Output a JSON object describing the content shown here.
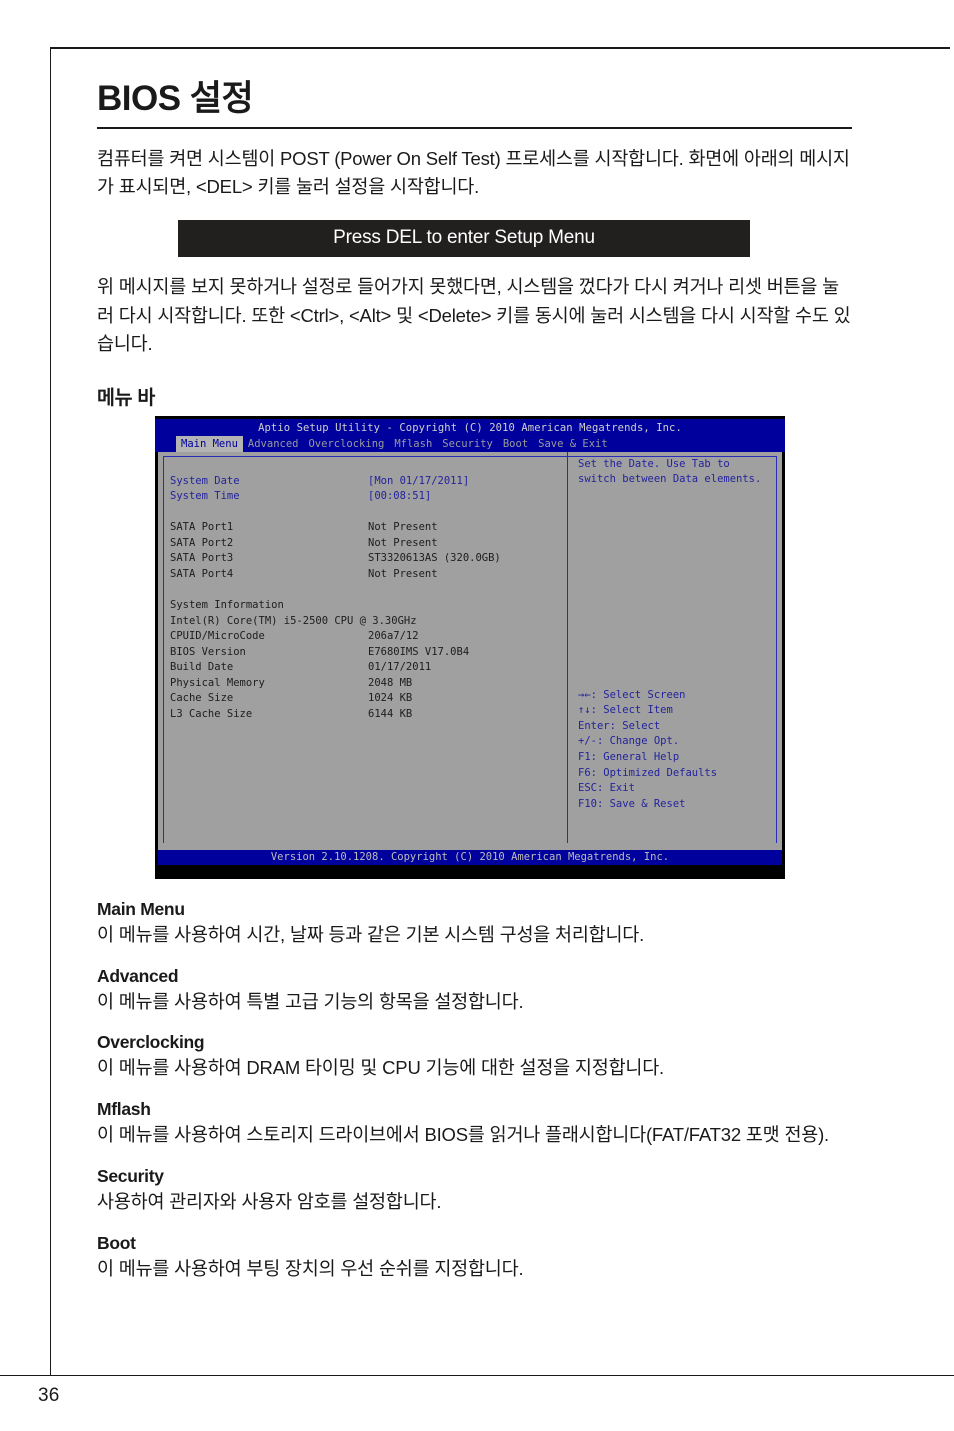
{
  "page": {
    "title": "BIOS 설정",
    "number": "36"
  },
  "intro": {
    "paragraph1": "컴퓨터를 켜면 시스템이 POST (Power On Self Test) 프로세스를 시작합니다. 화면에 아래의 메시지가 표시되면, <DEL> 키를 눌러 설정을 시작합니다.",
    "banner": "Press DEL to enter Setup Menu",
    "paragraph2": "위 메시지를 보지 못하거나 설정로 들어가지 못했다면, 시스템을 껐다가 다시 켜거나 리셋 버튼을 눌러 다시 시작합니다. 또한 <Ctrl>, <Alt> 및 <Delete> 키를 동시에 눌러 시스템을 다시 시작할 수도 있습니다."
  },
  "menubar_section": {
    "heading": "메뉴 바"
  },
  "bios": {
    "title": "Aptio Setup Utility - Copyright (C) 2010 American Megatrends, Inc.",
    "tabs": [
      {
        "label": "Main Menu",
        "active": true
      },
      {
        "label": "Advanced",
        "active": false
      },
      {
        "label": "Overclocking",
        "active": false
      },
      {
        "label": "Mflash",
        "active": false
      },
      {
        "label": "Security",
        "active": false
      },
      {
        "label": "Boot",
        "active": false
      },
      {
        "label": "Save & Exit",
        "active": false
      }
    ],
    "datetime": [
      {
        "label": "System Date",
        "value": "[Mon 01/17/2011]"
      },
      {
        "label": "System Time",
        "value": "[00:08:51]"
      }
    ],
    "sata": [
      {
        "label": "SATA Port1",
        "value": "Not Present"
      },
      {
        "label": "SATA Port2",
        "value": "Not Present"
      },
      {
        "label": "SATA Port3",
        "value": "ST3320613AS (320.0GB)"
      },
      {
        "label": "SATA Port4",
        "value": "Not Present"
      }
    ],
    "sysinfo_heading": "System Information",
    "cpu_line": "Intel(R) Core(TM) i5-2500 CPU @ 3.30GHz",
    "sysinfo": [
      {
        "label": "CPUID/MicroCode",
        "value": "206a7/12"
      },
      {
        "label": "BIOS Version",
        "value": "E7680IMS V17.0B4"
      },
      {
        "label": "Build Date",
        "value": "01/17/2011"
      },
      {
        "label": "Physical Memory",
        "value": "2048 MB"
      },
      {
        "label": "Cache Size",
        "value": "1024 KB"
      },
      {
        "label": "L3 Cache Size",
        "value": "6144 KB"
      }
    ],
    "help_lines": [
      "Set the Date. Use Tab to",
      "switch between Data elements."
    ],
    "key_legend": [
      "→←: Select Screen",
      "↑↓: Select Item",
      "Enter: Select",
      "+/-: Change Opt.",
      "F1: General Help",
      "F6: Optimized Defaults",
      "ESC: Exit",
      "F10: Save & Reset"
    ],
    "footer": "Version 2.10.1208. Copyright (C) 2010 American Megatrends, Inc."
  },
  "menu_descriptions": [
    {
      "name": "Main Menu",
      "text": "이 메뉴를 사용하여 시간, 날짜 등과 같은 기본 시스템 구성을 처리합니다."
    },
    {
      "name": "Advanced",
      "text": "이 메뉴를 사용하여 특별 고급 기능의 항목을 설정합니다."
    },
    {
      "name": "Overclocking",
      "text": "이 메뉴를 사용하여 DRAM 타이밍 및 CPU 기능에 대한 설정을 지정합니다."
    },
    {
      "name": "Mflash",
      "text": "이 메뉴를 사용하여 스토리지 드라이브에서 BIOS를 읽거나 플래시합니다(FAT/FAT32 포맷 전용)."
    },
    {
      "name": "Security",
      "text": "사용하여 관리자와 사용자 암호를 설정합니다."
    },
    {
      "name": "Boot",
      "text": "이 메뉴를 사용하여 부팅 장치의 우선 순쉬를 지정합니다."
    }
  ],
  "colors": {
    "bios_blue": "#00019c",
    "bios_gray": "#a0a0a0",
    "bios_text_blue": "#23239c",
    "banner_black": "#221f1f"
  }
}
